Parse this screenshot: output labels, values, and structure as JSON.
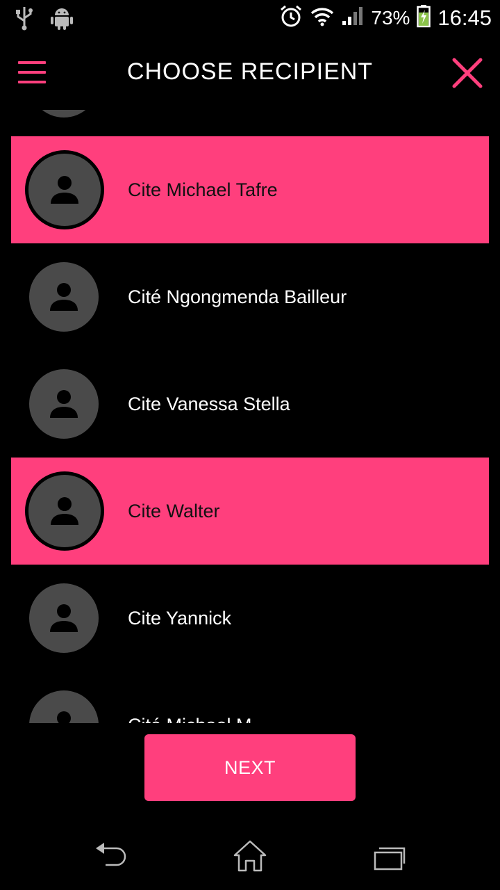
{
  "status_bar": {
    "battery_percent": "73%",
    "time": "16:45",
    "icons": [
      "usb-icon",
      "android-debug-icon",
      "alarm-icon",
      "wifi-icon",
      "signal-icon",
      "battery-charging-icon"
    ]
  },
  "app_bar": {
    "title": "CHOOSE RECIPIENT",
    "menu_icon": "hamburger-menu-icon",
    "close_icon": "close-icon"
  },
  "recipients": [
    {
      "name": "",
      "selected": false
    },
    {
      "name": "Cite Michael Tafre",
      "selected": true
    },
    {
      "name": "Cité Ngongmenda Bailleur",
      "selected": false
    },
    {
      "name": "Cite Vanessa Stella",
      "selected": false
    },
    {
      "name": "Cite Walter",
      "selected": true
    },
    {
      "name": "Cite Yannick",
      "selected": false
    },
    {
      "name": "Cité Michael M",
      "selected": false
    }
  ],
  "next_button": {
    "label": "NEXT"
  },
  "nav_bar": {
    "icons": [
      "back-icon",
      "home-icon",
      "recent-apps-icon"
    ]
  },
  "colors": {
    "accent": "#ff3f7d",
    "avatar_bg": "#4a4a4a",
    "background": "#000000"
  }
}
